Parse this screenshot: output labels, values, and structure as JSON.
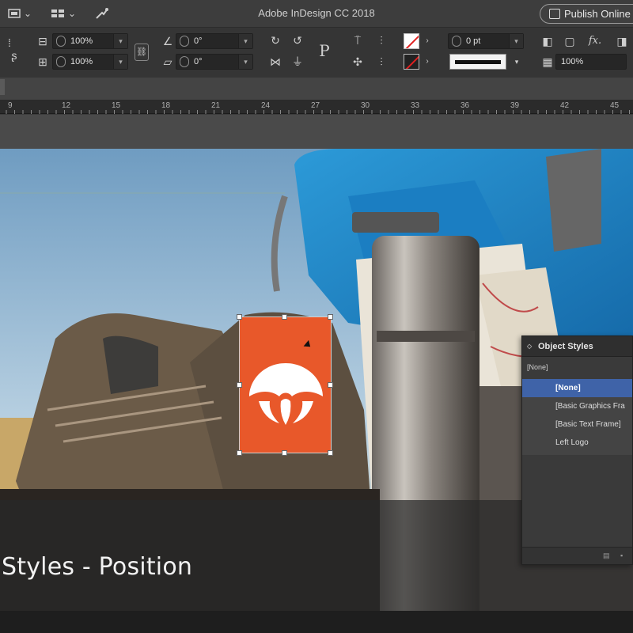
{
  "app": {
    "title": "Adobe InDesign CC 2018",
    "publish_label": "Publish Online"
  },
  "control_panel": {
    "scale_x": "100%",
    "scale_y": "100%",
    "rotation": "0°",
    "shear": "0°",
    "stroke_weight": "0 pt",
    "opacity": "100%",
    "fx_label": "fx."
  },
  "ruler": {
    "ticks": [
      "9",
      "12",
      "15",
      "18",
      "21",
      "24",
      "27",
      "30",
      "33",
      "36",
      "39",
      "42",
      "45"
    ]
  },
  "object_styles": {
    "title": "Object Styles",
    "current": "[None]",
    "items": [
      {
        "label": "[None]",
        "selected": true
      },
      {
        "label": "[Basic Graphics Fra",
        "selected": false
      },
      {
        "label": "[Basic Text Frame]",
        "selected": false
      },
      {
        "label": "Left Logo",
        "selected": false
      }
    ]
  },
  "caption": {
    "text": "Styles - Position"
  },
  "colors": {
    "logo_orange": "#e8582a",
    "panel_selection": "#3f63a8"
  }
}
